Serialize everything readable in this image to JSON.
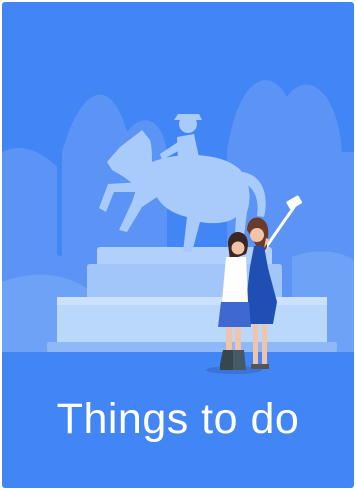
{
  "card": {
    "title": "Things to do",
    "illustration": "statue-and-selfie-tourists-illustration"
  },
  "colors": {
    "card_background": "#4285f4",
    "title_text": "#ffffff",
    "background_shapes": "#5b9af6",
    "statue": "#a8cbfb",
    "pedestal": "#b9d6fc"
  }
}
